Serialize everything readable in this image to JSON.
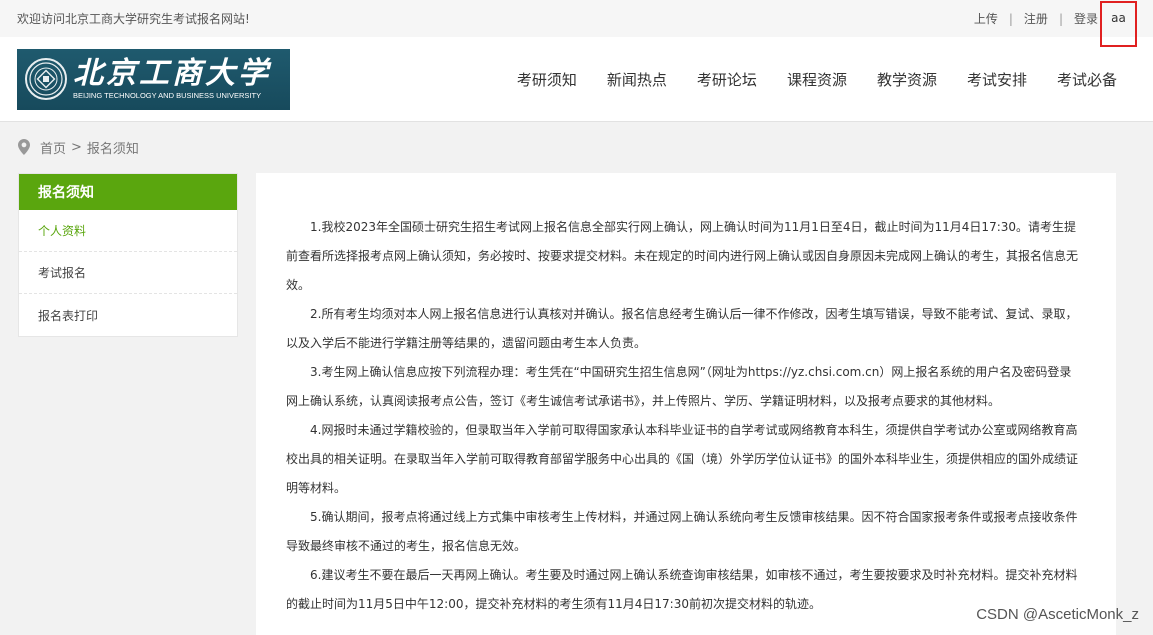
{
  "topbar": {
    "welcome": "欢迎访问北京工商大学研究生考试报名网站!",
    "upload": "上传",
    "register": "注册",
    "login": "登录",
    "username": "aa",
    "separator": "|"
  },
  "header": {
    "logo_cn": "北京工商大学",
    "logo_en": "BEIJING TECHNOLOGY AND BUSINESS UNIVERSITY",
    "nav": [
      {
        "label": "考研须知"
      },
      {
        "label": "新闻热点"
      },
      {
        "label": "考研论坛"
      },
      {
        "label": "课程资源"
      },
      {
        "label": "教学资源"
      },
      {
        "label": "考试安排"
      },
      {
        "label": "考试必备"
      }
    ]
  },
  "breadcrumb": {
    "home": "首页",
    "sep": ">",
    "current": "报名须知"
  },
  "sidebar": {
    "title": "报名须知",
    "items": [
      {
        "label": "个人资料"
      },
      {
        "label": "考试报名"
      },
      {
        "label": "报名表打印"
      }
    ]
  },
  "content": {
    "paragraphs": [
      "1.我校2023年全国硕士研究生招生考试网上报名信息全部实行网上确认，网上确认时间为11月1日至4日，截止时间为11月4日17:30。请考生提前查看所选择报考点网上确认须知，务必按时、按要求提交材料。未在规定的时间内进行网上确认或因自身原因未完成网上确认的考生，其报名信息无效。",
      "2.所有考生均须对本人网上报名信息进行认真核对并确认。报名信息经考生确认后一律不作修改，因考生填写错误，导致不能考试、复试、录取，以及入学后不能进行学籍注册等结果的，遗留问题由考生本人负责。",
      "3.考生网上确认信息应按下列流程办理：考生凭在“中国研究生招生信息网”（网址为https://yz.chsi.com.cn）网上报名系统的用户名及密码登录网上确认系统，认真阅读报考点公告，签订《考生诚信考试承诺书》，并上传照片、学历、学籍证明材料，以及报考点要求的其他材料。",
      "4.网报时未通过学籍校验的，但录取当年入学前可取得国家承认本科毕业证书的自学考试或网络教育本科生，须提供自学考试办公室或网络教育高校出具的相关证明。在录取当年入学前可取得教育部留学服务中心出具的《国（境）外学历学位认证书》的国外本科毕业生，须提供相应的国外成绩证明等材料。",
      "5.确认期间，报考点将通过线上方式集中审核考生上传材料，并通过网上确认系统向考生反馈审核结果。因不符合国家报考条件或报考点接收条件导致最终审核不通过的考生，报名信息无效。",
      "6.建议考生不要在最后一天再网上确认。考生要及时通过网上确认系统查询审核结果，如审核不通过，考生要按要求及时补充材料。提交补充材料的截止时间为11月5日中午12:00，提交补充材料的考生须有11月4日17:30前初次提交材料的轨迹。"
    ]
  },
  "watermark": "CSDN @AsceticMonk_z",
  "colors": {
    "accent_green": "#5aa60e",
    "logo_bg": "#1f5a6e",
    "highlight_red": "#e02020"
  }
}
